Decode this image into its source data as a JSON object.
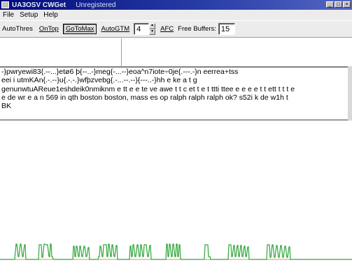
{
  "window": {
    "title": "UA3OSV CWGet",
    "status": "Unregistered",
    "minimize_glyph": "_",
    "maximize_glyph": "□",
    "close_glyph": "×"
  },
  "menu": {
    "file": "File",
    "setup": "Setup",
    "help": "Help"
  },
  "toolbar": {
    "auto_thres": "AutoThres",
    "on_top": "OnTop",
    "go_to_max": "GoToMax",
    "auto_gtm": "AutoGTM",
    "numeric_value": "4",
    "spin_up": "▲",
    "spin_down": "▼",
    "afc": "AFC",
    "free_buffers_label": "Free Buffers:",
    "free_buffers_value": "15"
  },
  "decoded_text": [
    "-}pwryewi83{.--...}etø6 þ{--..-}meg{-...--}eoa^n7iote÷0je{.---.-}n eerrea+tss",
    "eei i utmKAn{.-.--}u{.-.-.}wfþzvebg{.-...--.--}{---..-}hh e ke a t g",
    "genunwtuAReue1eshdeik0nmiknm e tt e e te ve awe t t c et t e t ttti ttee e e e e t t ett t t t e",
    "e de wr e a n 569 in qth boston boston, mass es op ralph ralph ralph ok? s52i k de w1h t",
    "BK"
  ],
  "colors": {
    "signal": "#2fa63a",
    "baseline": "#e8866a",
    "marker": "#e8866a"
  }
}
